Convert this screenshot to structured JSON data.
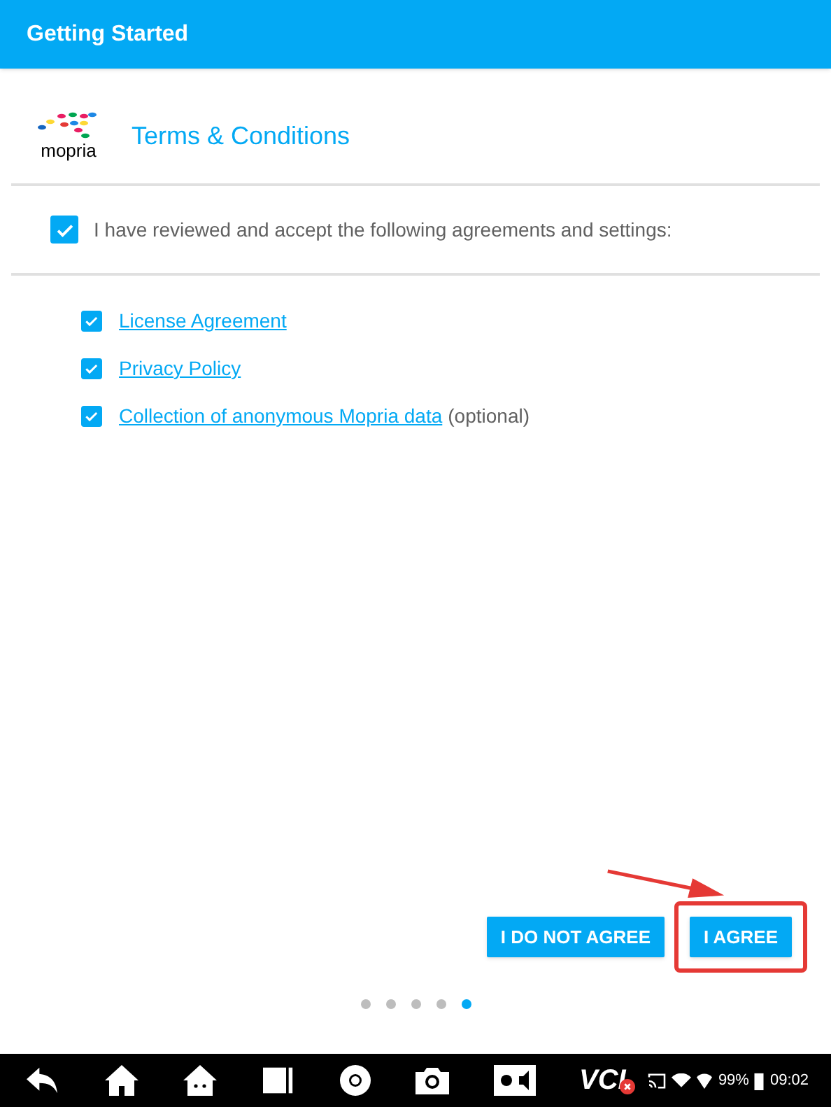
{
  "app_bar": {
    "title": "Getting Started"
  },
  "header": {
    "logo_text": "mopria",
    "title": "Terms & Conditions"
  },
  "accept_all": {
    "label": "I have reviewed and accept the following agreements and settings:",
    "checked": true
  },
  "agreements": [
    {
      "link": "License Agreement",
      "checked": true
    },
    {
      "link": "Privacy Policy",
      "checked": true
    },
    {
      "link": "Collection of anonymous Mopria data",
      "note": "(optional)",
      "checked": true
    }
  ],
  "buttons": [
    {
      "label": "I DO NOT AGREE",
      "highlighted": false
    },
    {
      "label": "I AGREE",
      "highlighted": true
    }
  ],
  "pager": [
    {
      "selected": false
    },
    {
      "selected": false
    },
    {
      "selected": false
    },
    {
      "selected": false
    },
    {
      "selected": true
    }
  ],
  "nav_bar": {
    "vci_label": "VCI",
    "battery": "99%",
    "time": "09:02"
  }
}
